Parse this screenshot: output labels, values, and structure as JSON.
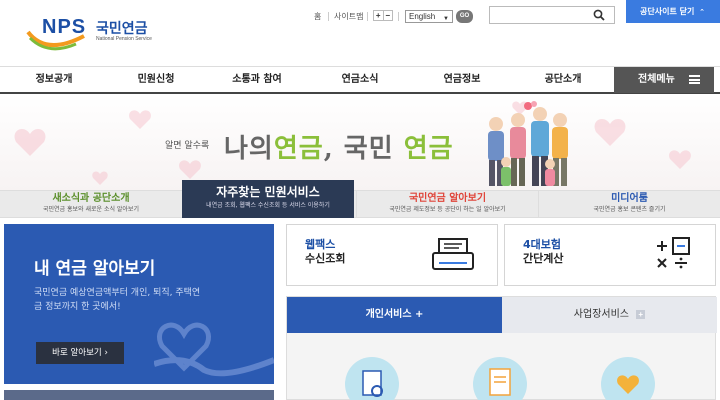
{
  "header": {
    "logo_mark": "NPS",
    "logo_korean": "국민연금",
    "logo_english": "National Pension Service",
    "util_home": "홈",
    "util_sitemap": "사이트맵",
    "font_plus": "+",
    "font_minus": "−",
    "language_value": "English",
    "go_label": "GO",
    "search_placeholder": "",
    "close_sites_label": "공단사이트 닫기"
  },
  "nav": {
    "items": [
      "정보공개",
      "민원신청",
      "소통과 참여",
      "연금소식",
      "연금정보",
      "공단소개"
    ],
    "menu_all": "전체메뉴"
  },
  "hero": {
    "tagline_small": "알면 알수록",
    "tagline_part1": "나의",
    "tagline_part2": "연금",
    "tagline_part3": ", 국민",
    "tagline_part4": "연금"
  },
  "strip": {
    "tabs": [
      {
        "title": "새소식과 공단소개",
        "sub": "국민연금 홍보와 새로운 소식 알아보기",
        "color": "#5a8f2a"
      },
      {
        "title": "자주찾는 민원서비스",
        "sub": "내연금 조회, 웹팩스 수신조회 등 서비스 이용하기"
      },
      {
        "title": "국민연금 알아보기",
        "sub": "국민연금 제도정보 등 공단이 하는 일 알아보기",
        "color": "#e0453a"
      },
      {
        "title": "미디어룸",
        "sub": "국민연금 홍보 콘텐츠 즐기기",
        "color": "#2b5ab2"
      }
    ]
  },
  "bluecard": {
    "title": "내 연금 알아보기",
    "desc": "국민연금 예상연금액부터 개인, 퇴직, 주택연금 정보까지 한 곳에서!",
    "button": "바로 알아보기 ›"
  },
  "services": [
    {
      "title": "웹팩스",
      "sub": "수신조회"
    },
    {
      "title": "4대보험",
      "sub": "간단계산"
    }
  ],
  "service_tabs": {
    "active": "개인서비스 +",
    "other": "사업장서비스"
  },
  "colors": {
    "brand_blue": "#2b5ab2",
    "nav_dark": "#555555",
    "strip_active": "#2b3a55"
  }
}
